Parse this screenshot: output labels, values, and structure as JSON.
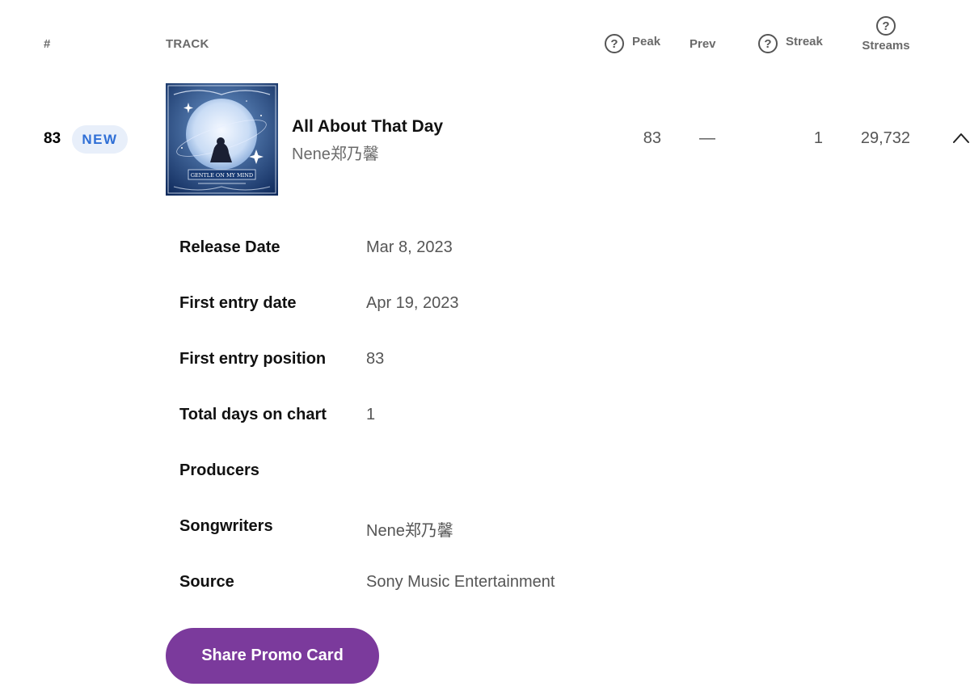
{
  "header": {
    "rank": "#",
    "track": "TRACK",
    "peak": "Peak",
    "prev": "Prev",
    "streak": "Streak",
    "streams": "Streams",
    "help_glyph": "?"
  },
  "row": {
    "rank": "83",
    "badge": "NEW",
    "title": "All About That Day",
    "artist": "Nene郑乃馨",
    "peak": "83",
    "prev": "—",
    "streak": "1",
    "streams": "29,732",
    "cover_art_text": "GENTLE ON MY MIND"
  },
  "details": [
    {
      "label": "Release Date",
      "value": "Mar 8, 2023"
    },
    {
      "label": "First entry date",
      "value": "Apr 19, 2023"
    },
    {
      "label": "First entry position",
      "value": "83"
    },
    {
      "label": "Total days on chart",
      "value": "1"
    },
    {
      "label": "Producers",
      "value": ""
    },
    {
      "label": "Songwriters",
      "value": "Nene郑乃馨"
    },
    {
      "label": "Source",
      "value": "Sony Music Entertainment"
    }
  ],
  "share_button": "Share Promo Card",
  "colors": {
    "badge_bg": "#e8effa",
    "badge_text": "#2f6fd6",
    "button_bg": "#7b3a9c",
    "muted_text": "#6a6a6a"
  },
  "icons": {
    "help": "help-circle-icon",
    "collapse": "chevron-up-icon"
  }
}
